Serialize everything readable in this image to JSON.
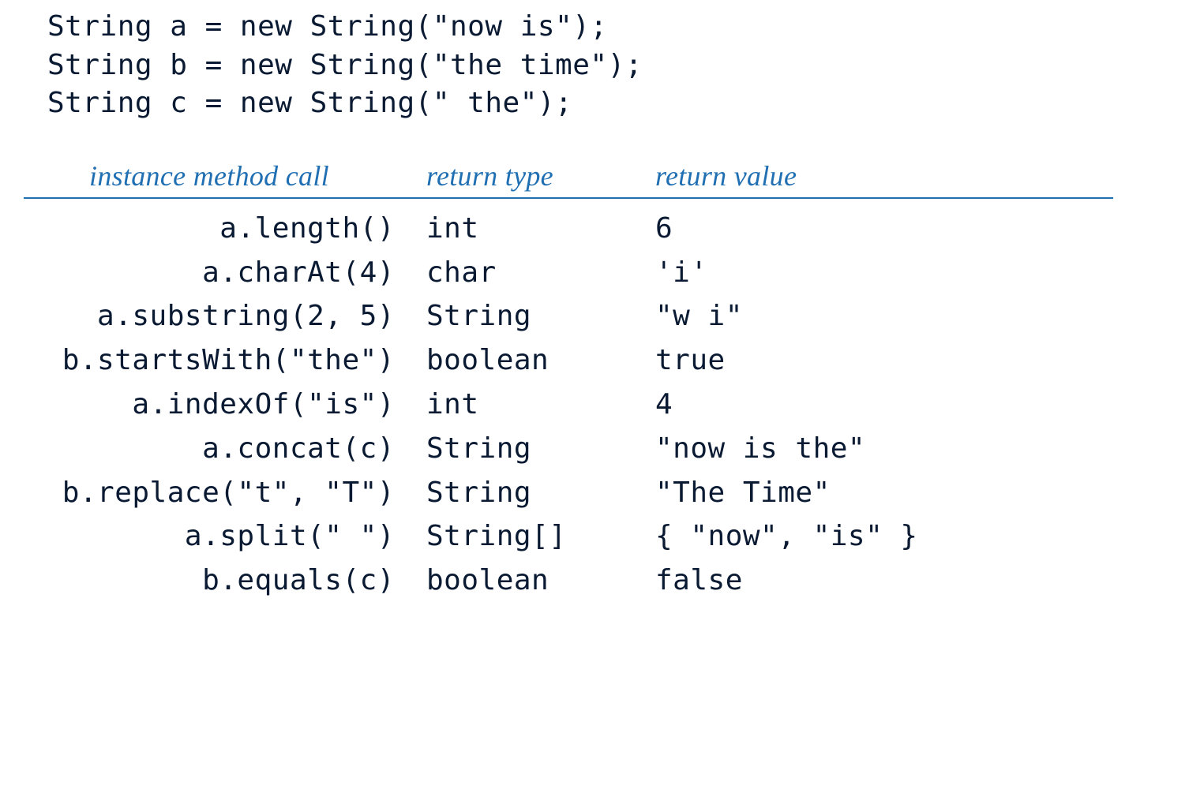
{
  "code_lines": [
    "String a = new String(\"now is\");",
    "String b = new String(\"the time\");",
    "String c = new String(\" the\");"
  ],
  "headers": {
    "call": "instance method call",
    "type": "return type",
    "value": "return value"
  },
  "rows": [
    {
      "call": "a.length()",
      "type": "int",
      "value": "6"
    },
    {
      "call": "a.charAt(4)",
      "type": "char",
      "value": "'i'"
    },
    {
      "call": "a.substring(2, 5)",
      "type": "String",
      "value": "\"w i\""
    },
    {
      "call": "b.startsWith(\"the\")",
      "type": "boolean",
      "value": "true"
    },
    {
      "call": "a.indexOf(\"is\")",
      "type": "int",
      "value": "4"
    },
    {
      "call": "a.concat(c)",
      "type": "String",
      "value": "\"now is the\""
    },
    {
      "call": "b.replace(\"t\", \"T\")",
      "type": "String",
      "value": "\"The Time\""
    },
    {
      "call": "a.split(\" \")",
      "type": "String[]",
      "value": "{ \"now\", \"is\" }"
    },
    {
      "call": "b.equals(c)",
      "type": "boolean",
      "value": "false"
    }
  ]
}
